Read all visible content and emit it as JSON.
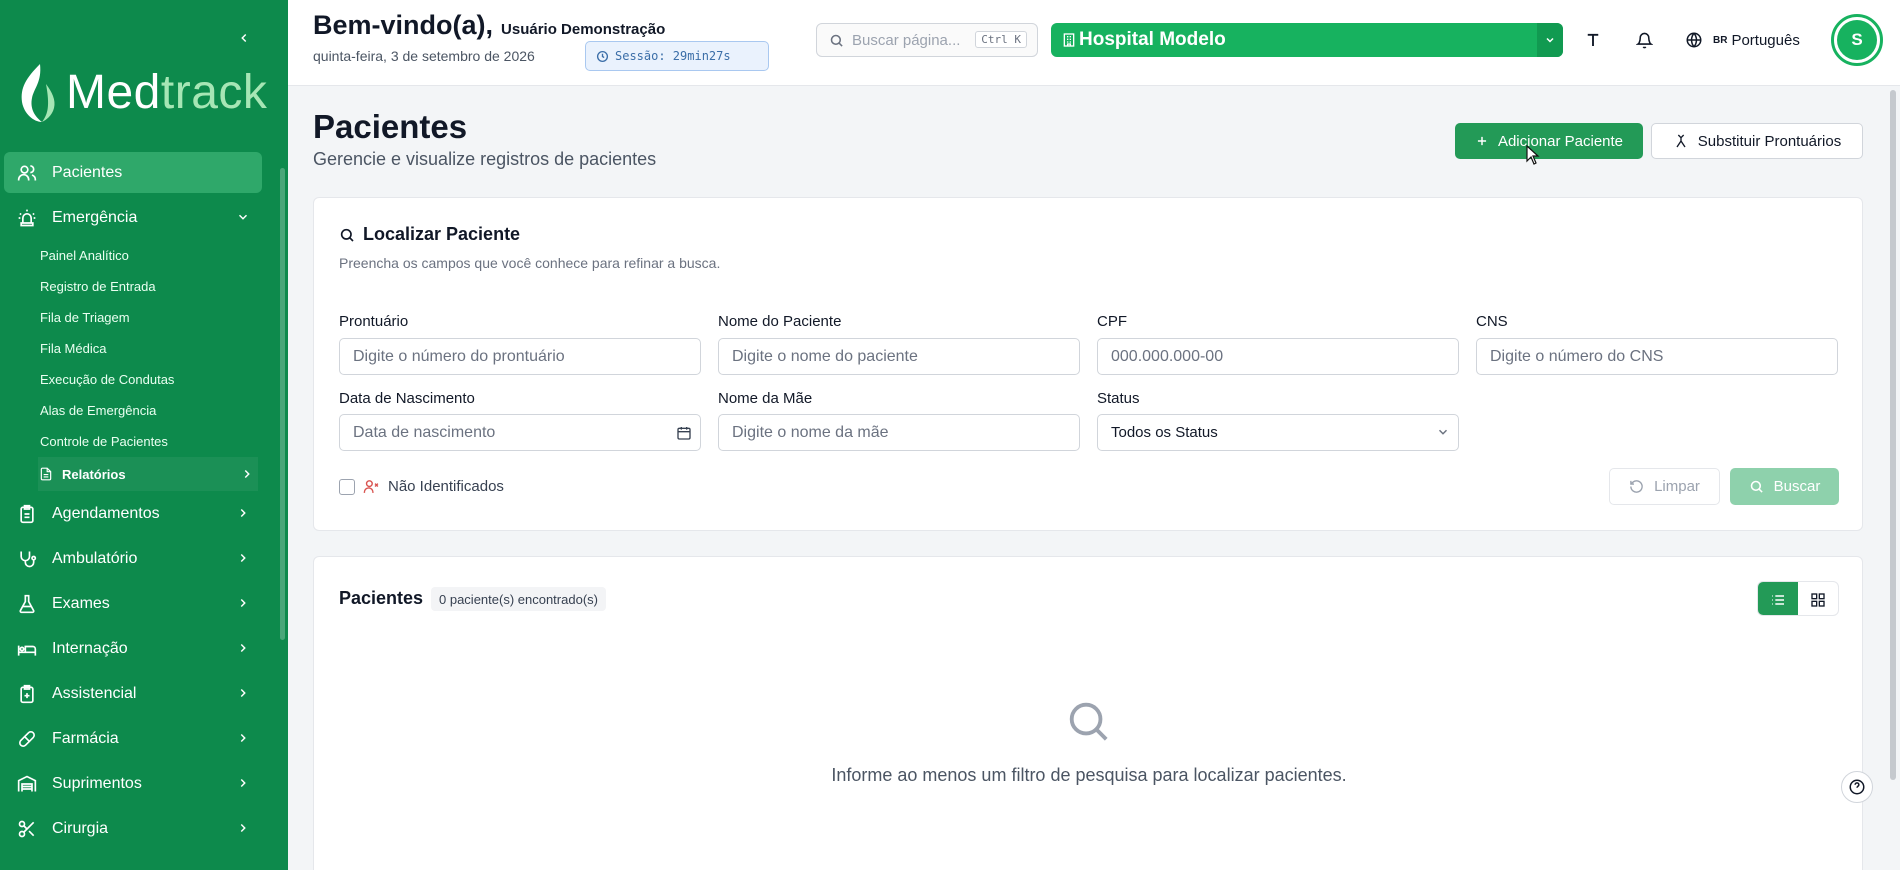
{
  "sidebar": {
    "logo": {
      "brand_part": "Med",
      "accent_part": "track"
    },
    "items": [
      {
        "label": "Pacientes",
        "icon": "users-icon",
        "active": true
      },
      {
        "label": "Emergência",
        "icon": "siren-icon",
        "expanded": true
      },
      {
        "label": "Agendamentos",
        "icon": "clipboard-icon"
      },
      {
        "label": "Ambulatório",
        "icon": "stethoscope-icon"
      },
      {
        "label": "Exames",
        "icon": "flask-icon"
      },
      {
        "label": "Internação",
        "icon": "bed-icon"
      },
      {
        "label": "Assistencial",
        "icon": "clipboard-plus-icon"
      },
      {
        "label": "Farmácia",
        "icon": "pill-icon"
      },
      {
        "label": "Suprimentos",
        "icon": "warehouse-icon"
      },
      {
        "label": "Cirurgia",
        "icon": "scissors-icon"
      }
    ],
    "emergencia_sub": [
      "Painel Analítico",
      "Registro de Entrada",
      "Fila de Triagem",
      "Fila Médica",
      "Execução de Condutas",
      "Alas de Emergência",
      "Controle de Pacientes"
    ],
    "relatorios_label": "Relatórios"
  },
  "header": {
    "welcome": "Bem-vindo(a),",
    "user": "Usuário Demonstração",
    "date": "quinta-feira, 3 de setembro de 2026",
    "session": "Sessão: 29min27s",
    "search_placeholder": "Buscar página...",
    "search_shortcut": "Ctrl K",
    "hospital": "Hospital Modelo",
    "language_flag": "BR",
    "language": "Português",
    "avatar_initial": "S"
  },
  "page": {
    "title": "Pacientes",
    "subtitle": "Gerencie e visualize registros de pacientes",
    "add_button": "Adicionar Paciente",
    "replace_button": "Substituir Prontuários"
  },
  "search_card": {
    "title": "Localizar Paciente",
    "description": "Preencha os campos que você conhece para refinar a busca.",
    "fields": {
      "prontuario": {
        "label": "Prontuário",
        "placeholder": "Digite o número do prontuário"
      },
      "nome": {
        "label": "Nome do Paciente",
        "placeholder": "Digite o nome do paciente"
      },
      "cpf": {
        "label": "CPF",
        "placeholder": "000.000.000-00"
      },
      "cns": {
        "label": "CNS",
        "placeholder": "Digite o número do CNS"
      },
      "nascimento": {
        "label": "Data de Nascimento",
        "placeholder": "Data de nascimento"
      },
      "mae": {
        "label": "Nome da Mãe",
        "placeholder": "Digite o nome da mãe"
      },
      "status": {
        "label": "Status",
        "value": "Todos os Status"
      }
    },
    "unidentified_label": "Não Identificados",
    "clear_button": "Limpar",
    "search_button": "Buscar"
  },
  "results": {
    "title": "Pacientes",
    "count": "0 paciente(s) encontrado(s)",
    "empty_message": "Informe ao menos um filtro de pesquisa para localizar pacientes."
  },
  "colors": {
    "sidebar_bg": "#0d8a4c",
    "primary": "#239a57",
    "hospital_bg": "#17b25f",
    "session_bg": "#eaf2fd"
  }
}
